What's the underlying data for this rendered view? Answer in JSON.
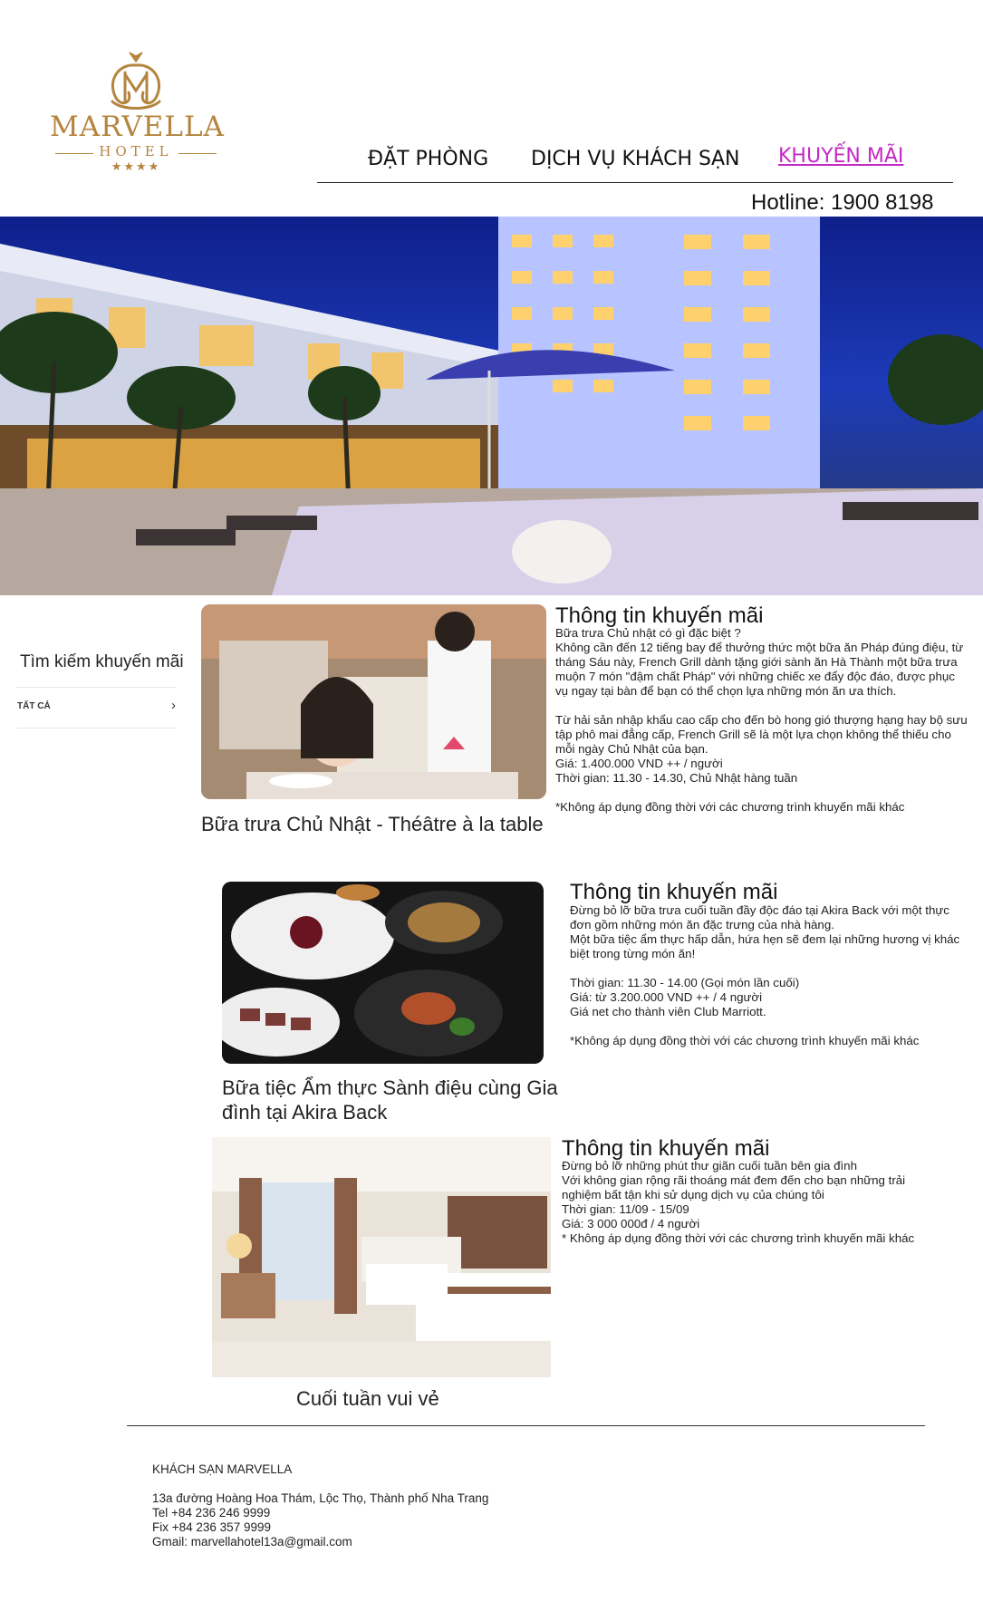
{
  "brand": {
    "name": "MARVELLA",
    "sub": "HOTEL",
    "stars": "★★★★"
  },
  "nav": {
    "items": [
      {
        "label": "ĐẶT PHÒNG"
      },
      {
        "label": "DỊCH VỤ KHÁCH SẠN"
      },
      {
        "label": "KHUYẾN MÃI"
      }
    ],
    "active_color": "#c42bc4"
  },
  "hotline": "Hotline: 1900 8198",
  "sidebar": {
    "title": "Tìm kiếm khuyến mãi",
    "filter": "TẤT CẢ"
  },
  "promos": [
    {
      "title": "Bữa trưa Chủ Nhật - Théâtre à la table",
      "info_heading": "Thông tin khuyến mãi",
      "info_text": "Bữa trưa Chủ nhật có gì đặc biệt ?\nKhông cần đến 12 tiếng bay để thưởng thức một bữa ăn Pháp đúng điệu, từ tháng Sáu này, French Grill dành tặng giới sành ăn Hà Thành một bữa trưa muộn 7 món \"đậm chất Pháp\" với những chiếc xe đẩy độc đáo, được phục vụ ngay tại bàn để bạn có thể chọn lựa những món ăn ưa thích.\n\nTừ hải sản nhập khẩu cao cấp cho đến bò hong gió thượng hạng hay bộ sưu tập phô mai đẳng cấp, French Grill sẽ là một lựa chọn không thể thiếu cho mỗi ngày Chủ Nhật của bạn.\nGiá: 1.400.000 VND ++ / người\nThời gian: 11.30 - 14.30, Chủ Nhật hàng tuần\n\n*Không áp dụng đồng thời với các chương trình khuyến mãi khác"
    },
    {
      "title": "Bữa tiệc Ẩm thực Sành điệu cùng Gia đình tại Akira Back",
      "info_heading": "Thông tin khuyến mãi",
      "info_text": "Đừng bỏ lỡ bữa trưa cuối tuần đầy độc đáo tại Akira Back với một thực đơn gồm những món ăn đặc trưng của nhà hàng.\nMột bữa tiệc ẩm thực hấp dẫn, hứa hẹn sẽ đem lại những hương vị khác biệt trong từng món ăn!\n\nThời gian: 11.30 - 14.00 (Gọi món lần cuối)\nGiá: từ 3.200.000 VND ++ / 4 người\nGiá net cho thành viên Club Marriott.\n\n*Không áp dụng đồng thời với các chương trình khuyến mãi khác"
    },
    {
      "title": "Cuối tuần vui vẻ",
      "info_heading": "Thông tin khuyến mãi",
      "info_text": "Đừng bỏ lỡ những phút thư giãn cuối tuần bên gia đình\nVới không gian rộng rãi thoáng mát đem đến cho bạn những trải nghiệm bất tận khi sử dụng dịch vụ của chúng tôi\nThời gian: 11/09 - 15/09\nGiá: 3 000 000đ / 4 người\n* Không áp dụng đồng thời với các chương trình khuyến mãi khác"
    }
  ],
  "footer": {
    "name": "KHÁCH SẠN MARVELLA",
    "lines": [
      "13a đường Hoàng Hoa Thám, Lộc Thọ, Thành phố Nha Trang",
      "Tel +84 236 246 9999",
      "Fix +84 236 357 9999",
      "Gmail: marvellahotel13a@gmail.com"
    ]
  }
}
